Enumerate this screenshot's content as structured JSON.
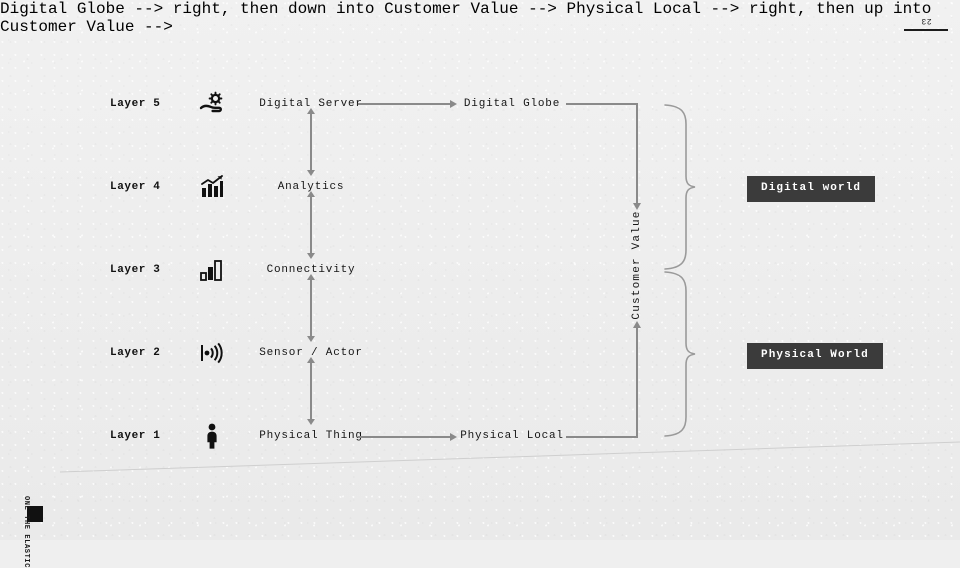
{
  "slide": {
    "page_number": "23",
    "footer_text": "ONE THE ELASTIC",
    "background_color": "#efefef"
  },
  "diagram": {
    "title": "",
    "layers": [
      {
        "label": "Layer 5",
        "icon": "hand-gear-icon",
        "node_a": "Digital Server",
        "node_b": "Digital Globe"
      },
      {
        "label": "Layer 4",
        "icon": "analytics-chart-icon",
        "node_a": "Analytics",
        "node_b": ""
      },
      {
        "label": "Layer 3",
        "icon": "signal-bars-icon",
        "node_a": "Connectivity",
        "node_b": ""
      },
      {
        "label": "Layer 2",
        "icon": "sensor-wave-icon",
        "node_a": "Sensor / Actor",
        "node_b": ""
      },
      {
        "label": "Layer 1",
        "icon": "person-icon",
        "node_a": "Physical Thing",
        "node_b": "Physical Local"
      }
    ],
    "customer_value_label": "Customer Value",
    "groups": [
      {
        "label": "Digital world",
        "chip_color": "#3b3b3b",
        "text_color": "#ffffff"
      },
      {
        "label": "Physical World",
        "chip_color": "#3b3b3b",
        "text_color": "#ffffff"
      }
    ],
    "connector_color": "#8a8a8a"
  }
}
